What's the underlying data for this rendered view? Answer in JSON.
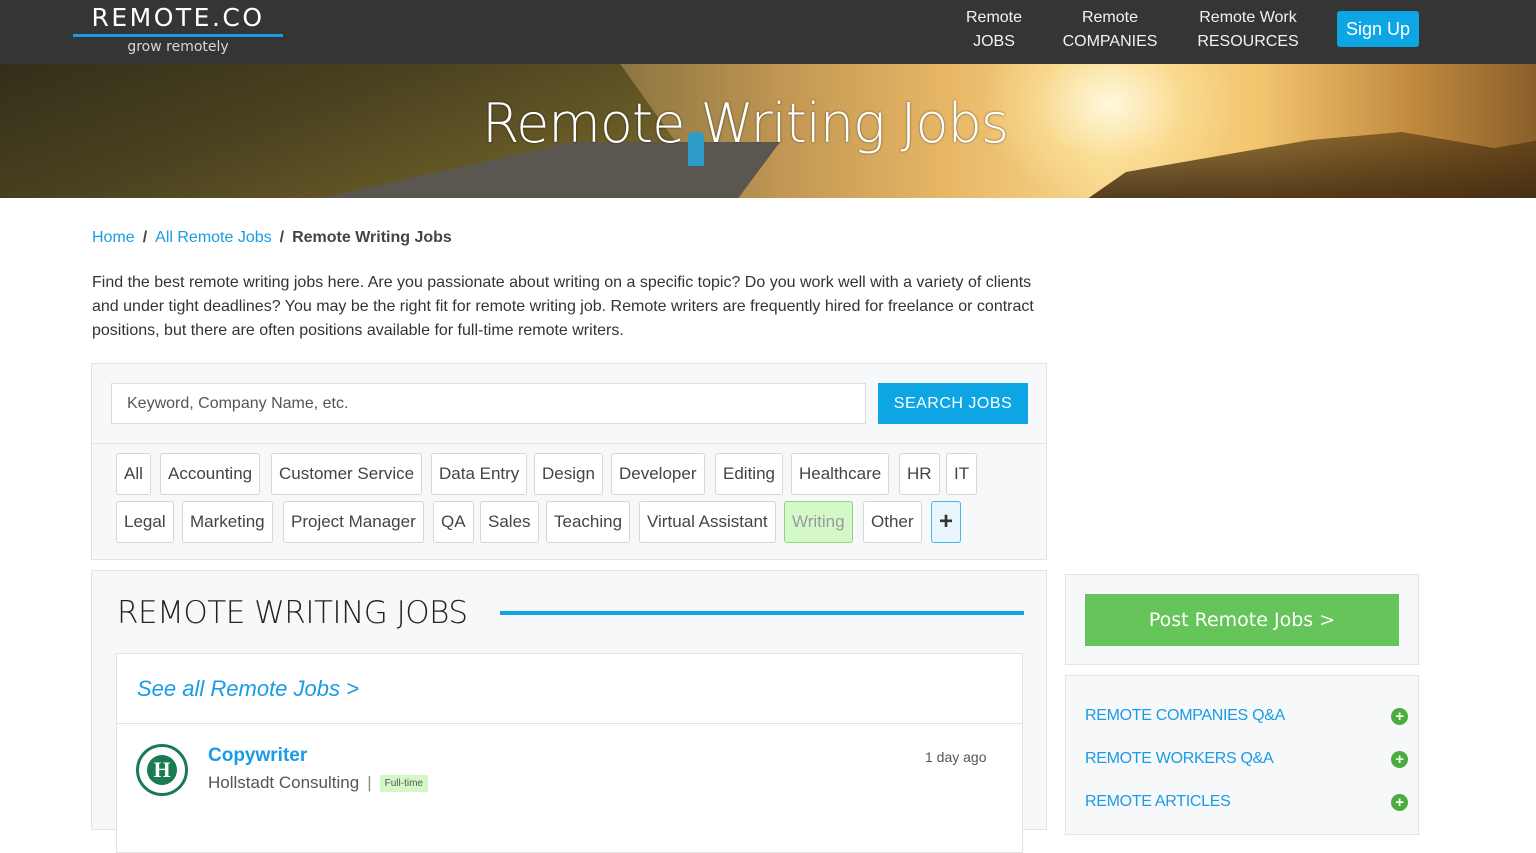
{
  "header": {
    "logo_title": "REMOTE.CO",
    "logo_tagline": "grow remotely",
    "nav": [
      {
        "line1": "Remote",
        "line2": "JOBS"
      },
      {
        "line1": "Remote",
        "line2": "COMPANIES"
      },
      {
        "line1": "Remote Work",
        "line2": "RESOURCES"
      }
    ],
    "signup_label": "Sign Up",
    "accent_color": "#0ea5e4"
  },
  "hero": {
    "title": "Remote Writing Jobs"
  },
  "breadcrumb": {
    "items": [
      "Home",
      "All Remote Jobs"
    ],
    "separator": "/",
    "current": "Remote Writing Jobs"
  },
  "intro": "Find the best remote writing jobs here. Are you passionate about writing on a specific topic? Do you work well with a variety of clients and under tight deadlines? You may be the right fit for remote writing job. Remote writers are frequently hired for freelance or contract positions, but there are often positions available for full-time remote writers.",
  "search": {
    "placeholder": "Keyword, Company Name, etc.",
    "value": "",
    "button_label": "SEARCH JOBS"
  },
  "categories": {
    "items": [
      "All",
      "Accounting",
      "Customer Service",
      "Data Entry",
      "Design",
      "Developer",
      "Editing",
      "Healthcare",
      "HR",
      "IT",
      "Legal",
      "Marketing",
      "Project Manager",
      "QA",
      "Sales",
      "Teaching",
      "Virtual Assistant",
      "Writing",
      "Other"
    ],
    "selected": "Writing",
    "more_label": "+"
  },
  "jobs": {
    "heading": "REMOTE WRITING JOBS",
    "see_all": "See all Remote Jobs >",
    "list": [
      {
        "title": "Copywriter",
        "company": "Hollstadt Consulting",
        "type": "Full-time",
        "posted": "1 day ago",
        "logo_letter": "H"
      }
    ]
  },
  "sidebar": {
    "post_button": "Post Remote Jobs >",
    "links": [
      "REMOTE COMPANIES Q&A",
      "REMOTE WORKERS Q&A",
      "REMOTE ARTICLES"
    ],
    "plus_color": "#4aae3f",
    "post_color": "#66c55a"
  }
}
